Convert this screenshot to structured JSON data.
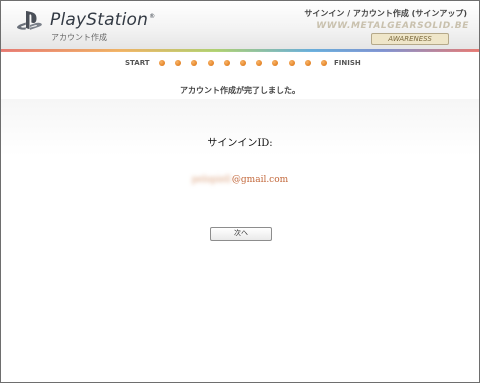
{
  "header": {
    "brand": "PlayStation",
    "trademark": "®",
    "subtitle": "アカウント作成",
    "page_title": "サインイン / アカウント作成 (サインアップ)",
    "watermark": "WWW.METALGEARSOLID.BE",
    "badge": "AWARENESS"
  },
  "steps": {
    "start_label": "START",
    "finish_label": "FINISH",
    "total": 11,
    "completed": 11
  },
  "main": {
    "complete_message": "アカウント作成が完了しました。",
    "signin_id_label": "サインインID:",
    "email_user_redacted": "pelopiell",
    "email_domain": "@gmail.com",
    "next_button_label": "次へ"
  },
  "colors": {
    "step_dot": "#e88a2e",
    "email_text": "#c2673a",
    "header_bg": "#ededed"
  },
  "icons": {
    "logo": "playstation-logo-icon"
  }
}
